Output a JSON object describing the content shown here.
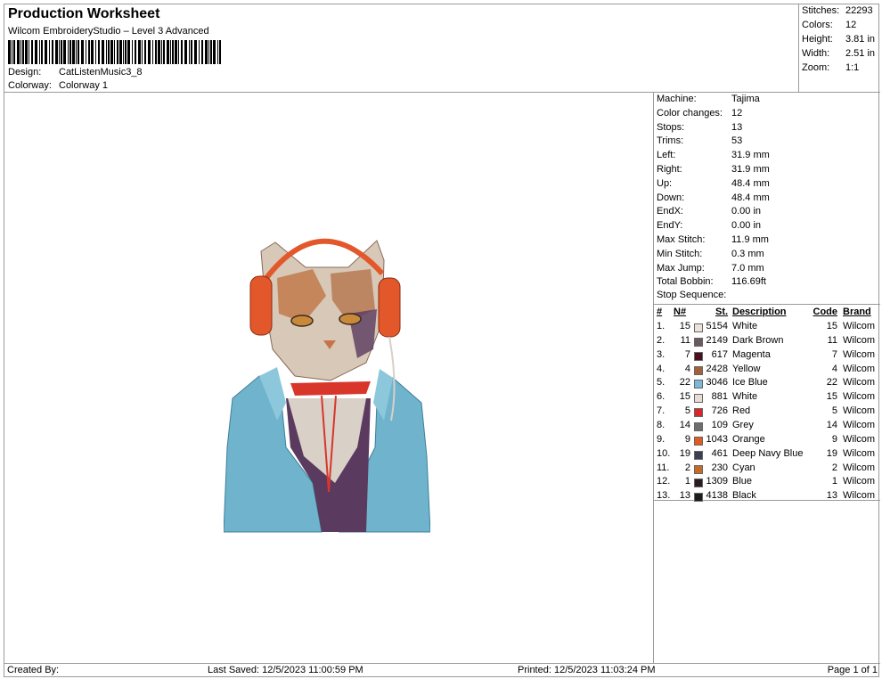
{
  "header": {
    "title": "Production Worksheet",
    "software": "Wilcom EmbroideryStudio – Level 3 Advanced",
    "design_label": "Design:",
    "design_value": "CatListenMusic3_8",
    "colorway_label": "Colorway:",
    "colorway_value": "Colorway 1"
  },
  "summary": {
    "stitches_label": "Stitches:",
    "stitches": "22293",
    "colors_label": "Colors:",
    "colors": "12",
    "height_label": "Height:",
    "height": "3.81 in",
    "width_label": "Width:",
    "width": "2.51 in",
    "zoom_label": "Zoom:",
    "zoom": "1:1"
  },
  "info": [
    {
      "k": "Machine:",
      "v": "Tajima"
    },
    {
      "k": "Color changes:",
      "v": "12"
    },
    {
      "k": "Stops:",
      "v": "13"
    },
    {
      "k": "Trims:",
      "v": "53"
    },
    {
      "k": "Left:",
      "v": "31.9 mm"
    },
    {
      "k": "Right:",
      "v": "31.9 mm"
    },
    {
      "k": "Up:",
      "v": "48.4 mm"
    },
    {
      "k": "Down:",
      "v": "48.4 mm"
    },
    {
      "k": "EndX:",
      "v": "0.00 in"
    },
    {
      "k": "EndY:",
      "v": "0.00 in"
    },
    {
      "k": "Max Stitch:",
      "v": "11.9 mm"
    },
    {
      "k": "Min Stitch:",
      "v": "0.3 mm"
    },
    {
      "k": "Max Jump:",
      "v": "7.0 mm"
    },
    {
      "k": "Total Bobbin:",
      "v": "116.69ft"
    }
  ],
  "stop_sequence": {
    "title": "Stop Sequence:",
    "headers": {
      "num": "#",
      "n": "N#",
      "st": "St.",
      "desc": "Description",
      "code": "Code",
      "brand": "Brand"
    },
    "rows": [
      {
        "num": "1.",
        "n": "15",
        "color": "#efe1d8",
        "st": "5154",
        "desc": "White",
        "code": "15",
        "brand": "Wilcom"
      },
      {
        "num": "2.",
        "n": "11",
        "color": "#6b5a5e",
        "st": "2149",
        "desc": "Dark Brown",
        "code": "11",
        "brand": "Wilcom"
      },
      {
        "num": "3.",
        "n": "7",
        "color": "#4a1020",
        "st": "617",
        "desc": "Magenta",
        "code": "7",
        "brand": "Wilcom"
      },
      {
        "num": "4.",
        "n": "4",
        "color": "#a4603a",
        "st": "2428",
        "desc": "Yellow",
        "code": "4",
        "brand": "Wilcom"
      },
      {
        "num": "5.",
        "n": "22",
        "color": "#7cb8d8",
        "st": "3046",
        "desc": "Ice Blue",
        "code": "22",
        "brand": "Wilcom"
      },
      {
        "num": "6.",
        "n": "15",
        "color": "#e8dcd4",
        "st": "881",
        "desc": "White",
        "code": "15",
        "brand": "Wilcom"
      },
      {
        "num": "7.",
        "n": "5",
        "color": "#d8262a",
        "st": "726",
        "desc": "Red",
        "code": "5",
        "brand": "Wilcom"
      },
      {
        "num": "8.",
        "n": "14",
        "color": "#6e6e6e",
        "st": "109",
        "desc": "Grey",
        "code": "14",
        "brand": "Wilcom"
      },
      {
        "num": "9.",
        "n": "9",
        "color": "#e25a1e",
        "st": "1043",
        "desc": "Orange",
        "code": "9",
        "brand": "Wilcom"
      },
      {
        "num": "10.",
        "n": "19",
        "color": "#3b3f52",
        "st": "461",
        "desc": "Deep Navy Blue",
        "code": "19",
        "brand": "Wilcom"
      },
      {
        "num": "11.",
        "n": "2",
        "color": "#c96a22",
        "st": "230",
        "desc": "Cyan",
        "code": "2",
        "brand": "Wilcom"
      },
      {
        "num": "12.",
        "n": "1",
        "color": "#2a1a22",
        "st": "1309",
        "desc": "Blue",
        "code": "1",
        "brand": "Wilcom"
      },
      {
        "num": "13.",
        "n": "13",
        "color": "#1c1c1c",
        "st": "4138",
        "desc": "Black",
        "code": "13",
        "brand": "Wilcom"
      }
    ]
  },
  "footer": {
    "created_by": "Created By:",
    "last_saved": "Last Saved: 12/5/2023 11:00:59 PM",
    "printed": "Printed: 12/5/2023 11:03:24 PM",
    "page": "Page 1 of 1"
  }
}
